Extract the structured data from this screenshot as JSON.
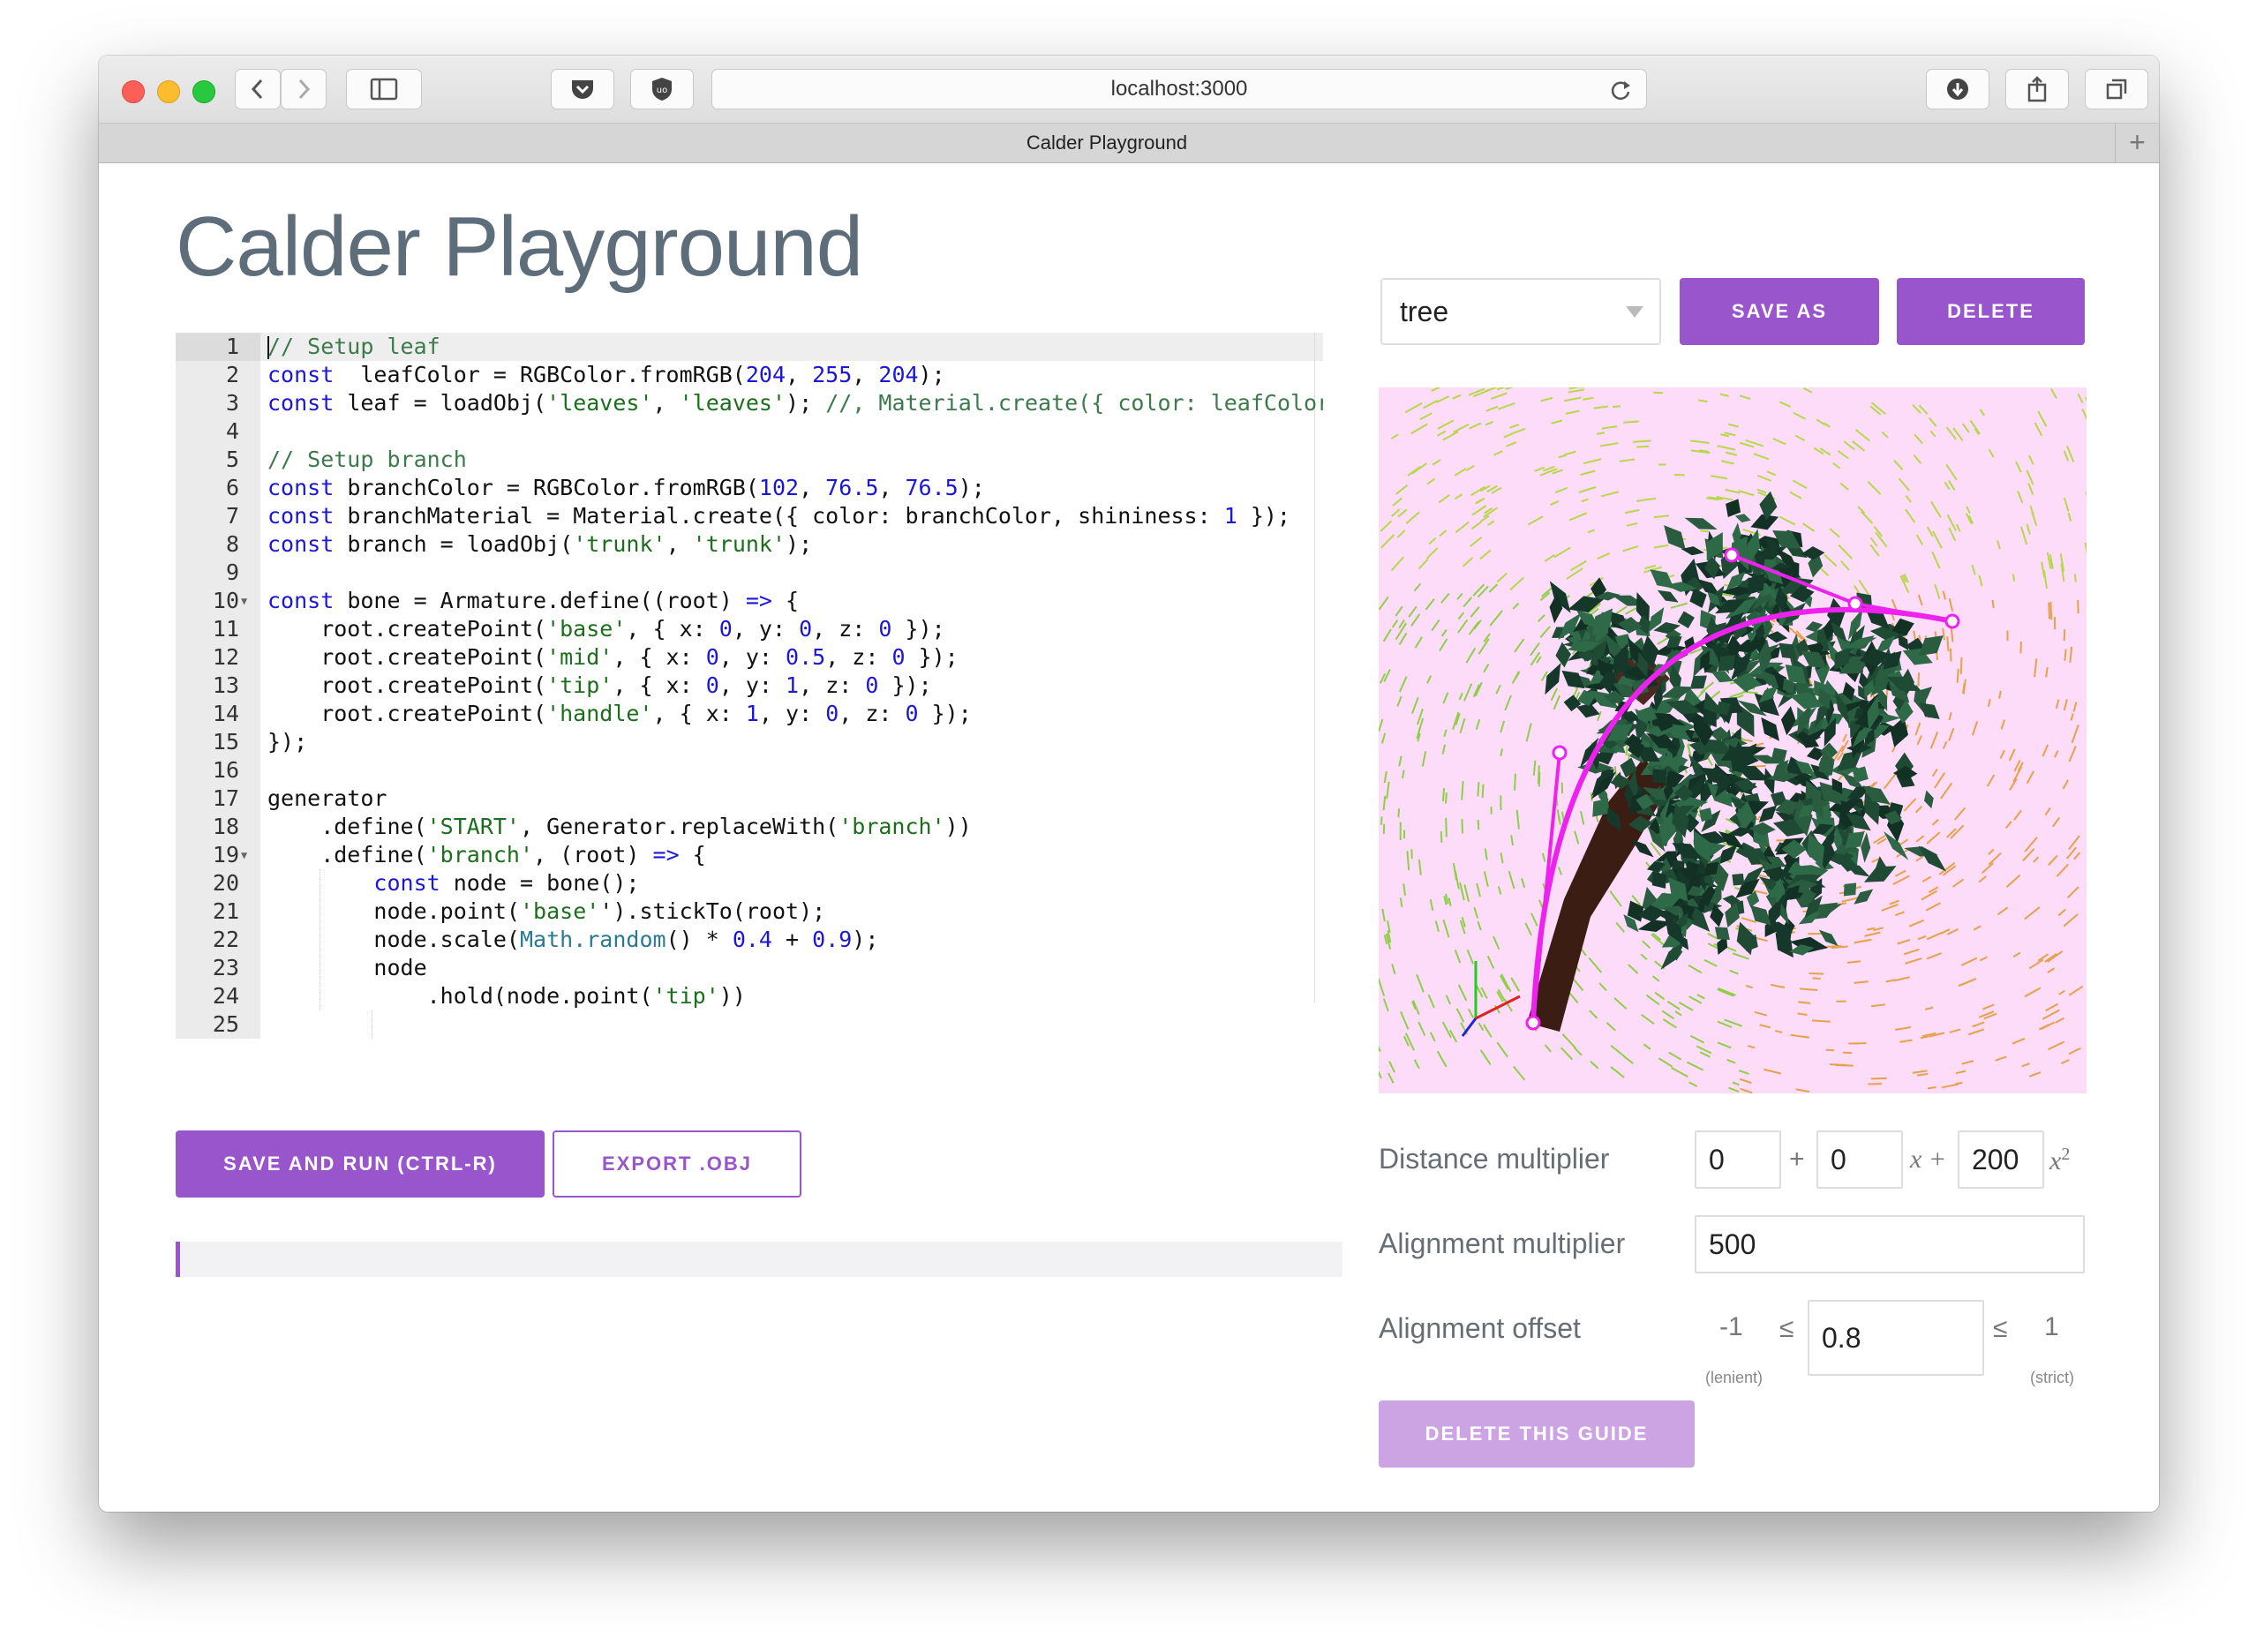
{
  "browser": {
    "url": "localhost:3000",
    "tab_title": "Calder Playground",
    "new_tab": "+"
  },
  "page": {
    "title": "Calder Playground"
  },
  "preset": {
    "selected": "tree",
    "save_as": "SAVE AS",
    "delete": "DELETE"
  },
  "editor": {
    "lines": [
      {
        "n": "1",
        "parts": [
          [
            "cm",
            "// Setup leaf"
          ]
        ]
      },
      {
        "n": "2",
        "parts": [
          [
            "kw",
            "const"
          ],
          [
            "",
            "  leafColor = RGBColor.fromRGB("
          ],
          [
            "nm",
            "204"
          ],
          [
            "",
            ", "
          ],
          [
            "nm",
            "255"
          ],
          [
            "",
            ", "
          ],
          [
            "nm",
            "204"
          ],
          [
            "",
            ");"
          ]
        ]
      },
      {
        "n": "3",
        "parts": [
          [
            "kw",
            "const"
          ],
          [
            "",
            " leaf = loadObj("
          ],
          [
            "st",
            "'leaves'"
          ],
          [
            "",
            ", "
          ],
          [
            "st",
            "'leaves'"
          ],
          [
            "",
            "); "
          ],
          [
            "cm",
            "//, Material.create({ color: leafColor,"
          ]
        ]
      },
      {
        "n": "4",
        "parts": []
      },
      {
        "n": "5",
        "parts": [
          [
            "cm",
            "// Setup branch"
          ]
        ]
      },
      {
        "n": "6",
        "parts": [
          [
            "kw",
            "const"
          ],
          [
            "",
            " branchColor = RGBColor.fromRGB("
          ],
          [
            "nm",
            "102"
          ],
          [
            "",
            ", "
          ],
          [
            "nm",
            "76.5"
          ],
          [
            "",
            ", "
          ],
          [
            "nm",
            "76.5"
          ],
          [
            "",
            ");"
          ]
        ]
      },
      {
        "n": "7",
        "parts": [
          [
            "kw",
            "const"
          ],
          [
            "",
            " branchMaterial = Material.create({ color: branchColor, shininess: "
          ],
          [
            "nm",
            "1"
          ],
          [
            "",
            " });"
          ]
        ]
      },
      {
        "n": "8",
        "parts": [
          [
            "kw",
            "const"
          ],
          [
            "",
            " branch = loadObj("
          ],
          [
            "st",
            "'trunk'"
          ],
          [
            "",
            ", "
          ],
          [
            "st",
            "'trunk'"
          ],
          [
            "",
            ");"
          ]
        ]
      },
      {
        "n": "9",
        "parts": []
      },
      {
        "n": "10",
        "fold": true,
        "parts": [
          [
            "kw",
            "const"
          ],
          [
            "",
            " bone = Armature.define((root) "
          ],
          [
            "kw",
            "=>"
          ],
          [
            "",
            " {"
          ]
        ]
      },
      {
        "n": "11",
        "parts": [
          [
            "",
            "    root.createPoint("
          ],
          [
            "st",
            "'base'"
          ],
          [
            "",
            ", { x: "
          ],
          [
            "nm",
            "0"
          ],
          [
            "",
            ", y: "
          ],
          [
            "nm",
            "0"
          ],
          [
            "",
            ", z: "
          ],
          [
            "nm",
            "0"
          ],
          [
            "",
            " });"
          ]
        ]
      },
      {
        "n": "12",
        "parts": [
          [
            "",
            "    root.createPoint("
          ],
          [
            "st",
            "'mid'"
          ],
          [
            "",
            ", { x: "
          ],
          [
            "nm",
            "0"
          ],
          [
            "",
            ", y: "
          ],
          [
            "nm",
            "0.5"
          ],
          [
            "",
            ", z: "
          ],
          [
            "nm",
            "0"
          ],
          [
            "",
            " });"
          ]
        ]
      },
      {
        "n": "13",
        "parts": [
          [
            "",
            "    root.createPoint("
          ],
          [
            "st",
            "'tip'"
          ],
          [
            "",
            ", { x: "
          ],
          [
            "nm",
            "0"
          ],
          [
            "",
            ", y: "
          ],
          [
            "nm",
            "1"
          ],
          [
            "",
            ", z: "
          ],
          [
            "nm",
            "0"
          ],
          [
            "",
            " });"
          ]
        ]
      },
      {
        "n": "14",
        "parts": [
          [
            "",
            "    root.createPoint("
          ],
          [
            "st",
            "'handle'"
          ],
          [
            "",
            ", { x: "
          ],
          [
            "nm",
            "1"
          ],
          [
            "",
            ", y: "
          ],
          [
            "nm",
            "0"
          ],
          [
            "",
            ", z: "
          ],
          [
            "nm",
            "0"
          ],
          [
            "",
            " });"
          ]
        ]
      },
      {
        "n": "15",
        "parts": [
          [
            "",
            "});"
          ]
        ]
      },
      {
        "n": "16",
        "parts": []
      },
      {
        "n": "17",
        "parts": [
          [
            "",
            "generator"
          ]
        ]
      },
      {
        "n": "18",
        "parts": [
          [
            "",
            "    .define("
          ],
          [
            "st",
            "'START'"
          ],
          [
            "",
            ", Generator.replaceWith("
          ],
          [
            "st",
            "'branch'"
          ],
          [
            "",
            "))"
          ]
        ]
      },
      {
        "n": "19",
        "fold": true,
        "parts": [
          [
            "",
            "    .define("
          ],
          [
            "st",
            "'branch'"
          ],
          [
            "",
            ", (root) "
          ],
          [
            "kw",
            "=>"
          ],
          [
            "",
            " {"
          ]
        ]
      },
      {
        "n": "20",
        "parts": [
          [
            "",
            "        "
          ],
          [
            "kw",
            "const"
          ],
          [
            "",
            " node = bone();"
          ]
        ]
      },
      {
        "n": "21",
        "parts": [
          [
            "",
            "        node.point("
          ],
          [
            "st",
            "'base'"
          ],
          [
            "",
            "').stickTo(root);"
          ]
        ]
      },
      {
        "n": "22",
        "parts": [
          [
            "",
            "        node.scale("
          ],
          [
            "bi",
            "Math.random"
          ],
          [
            "",
            "() * "
          ],
          [
            "nm",
            "0.4"
          ],
          [
            "",
            " + "
          ],
          [
            "nm",
            "0.9"
          ],
          [
            "",
            ");"
          ]
        ]
      },
      {
        "n": "23",
        "parts": [
          [
            "",
            "        node"
          ]
        ]
      },
      {
        "n": "24",
        "parts": [
          [
            "",
            "            .hold(node.point("
          ],
          [
            "st",
            "'tip'"
          ],
          [
            "",
            "))"
          ]
        ]
      },
      {
        "n": "25",
        "parts": []
      }
    ]
  },
  "actions": {
    "save_run": "SAVE AND RUN (CTRL-R)",
    "export": "EXPORT .OBJ"
  },
  "guide": {
    "distance_label": "Distance multiplier",
    "distance_c": "0",
    "plus1": "+",
    "distance_x": "0",
    "x_term": "x +",
    "distance_x2": "200",
    "x2_term": "x",
    "x2_exp": "2",
    "alignment_label": "Alignment multiplier",
    "alignment_value": "500",
    "offset_label": "Alignment offset",
    "offset_min": "-1",
    "offset_min_note": "(lenient)",
    "le1": "≤",
    "offset_value": "0.8",
    "le2": "≤",
    "offset_max": "1",
    "offset_max_note": "(strict)",
    "delete_guide": "DELETE THIS GUIDE"
  },
  "colors": {
    "accent": "#9955cc",
    "accent_disabled": "#cca4e4",
    "viewport_bg": "#fcdcf8",
    "guide_curve": "#ee22ee",
    "foliage": "#1f4a34"
  }
}
